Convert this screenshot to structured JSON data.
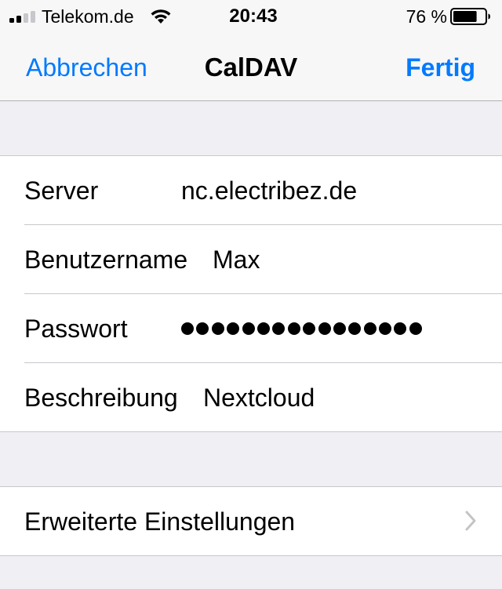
{
  "status_bar": {
    "carrier": "Telekom.de",
    "time": "20:43",
    "battery_percent": "76 %",
    "battery_level": 0.76,
    "signal_bars_filled": 2,
    "signal_bars_total": 4
  },
  "nav": {
    "cancel_label": "Abbrechen",
    "title": "CalDAV",
    "done_label": "Fertig"
  },
  "account": {
    "server_label": "Server",
    "server_value": "nc.electribez.de",
    "username_label": "Benutzername",
    "username_value": "Max",
    "password_label": "Passwort",
    "password_mask_length": 16,
    "description_label": "Beschreibung",
    "description_value": "Nextcloud"
  },
  "advanced": {
    "label": "Erweiterte Einstellungen",
    "icon": "chevron-right-icon"
  },
  "colors": {
    "accent": "#007aff",
    "background": "#efeff4",
    "separator": "#c8c7cc"
  }
}
